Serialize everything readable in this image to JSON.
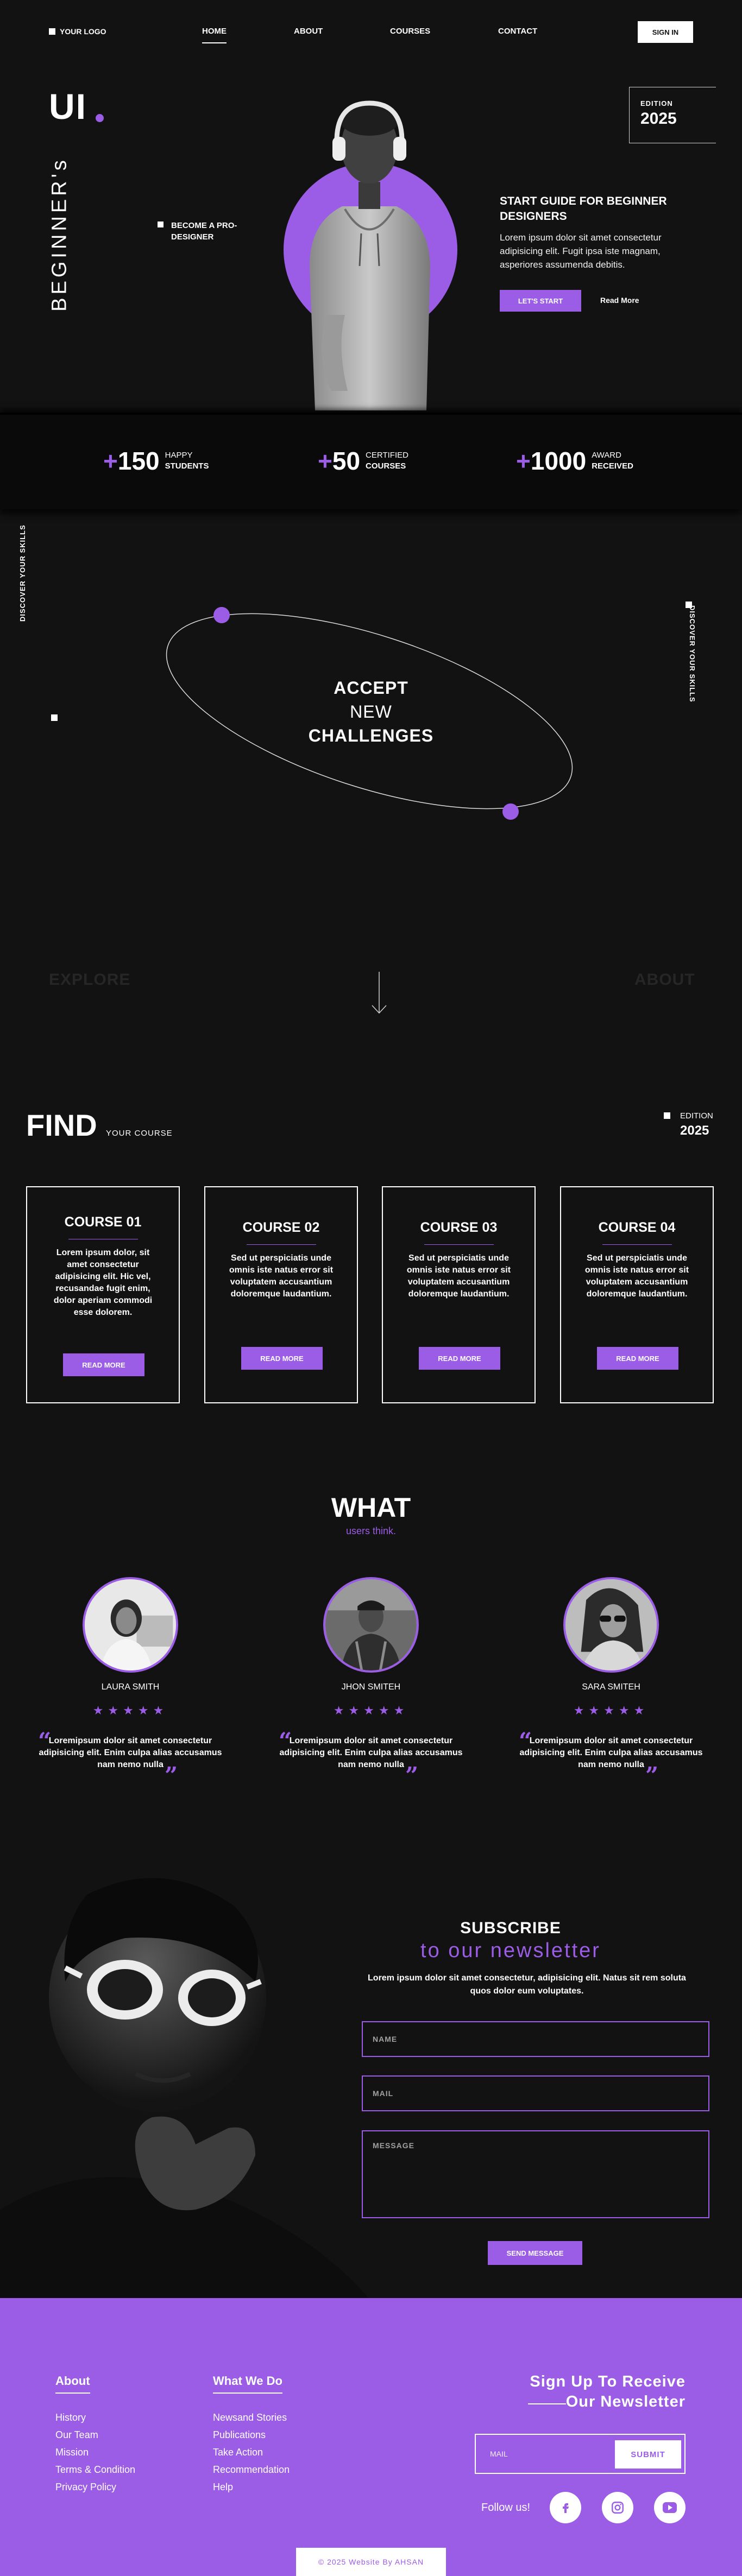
{
  "nav": {
    "logo": "YOUR LOGO",
    "links": [
      "HOME",
      "ABOUT",
      "COURSES",
      "CONTACT"
    ],
    "signin": "SIGN IN"
  },
  "hero": {
    "big": "UI",
    "vertical": "BEGINNER's",
    "become": "BECOME A PRO-DESIGNER",
    "edition_label": "EDITION",
    "edition_year": "2025",
    "title": "START GUIDE FOR BEGINNER DESIGNERS",
    "body": "Lorem ipsum dolor sit amet consectetur adipisicing elit. Fugit ipsa iste magnam, asperiores assumenda debitis.",
    "cta": "LET'S START",
    "read_more": "Read More"
  },
  "stats": [
    {
      "plus": "+",
      "num": "150",
      "l1": "HAPPY",
      "l2": "STUDENTS"
    },
    {
      "plus": "+",
      "num": "50",
      "l1": "CERTIFIED",
      "l2": "COURSES"
    },
    {
      "plus": "+",
      "num": "1000",
      "l1": "AWARD",
      "l2": "RECEIVED"
    }
  ],
  "accept": {
    "side_left": "DISCOVER YOUR SKILLS",
    "side_right": "DISCOVER YOUR SKILLS",
    "line1": "ACCEPT",
    "line2": "NEW",
    "line3": "CHALLENGES",
    "explore": "EXPLORE",
    "about": "ABOUT"
  },
  "find": {
    "title": "FIND",
    "sub": "YOUR COURSE",
    "edition_label": "EDITION",
    "edition_year": "2025",
    "courses": [
      {
        "title": "COURSE 01",
        "body": "Lorem ipsum dolor, sit amet consectetur adipisicing elit. Hic vel, recusandae fugit enim, dolor aperiam commodi esse dolorem.",
        "btn": "READ MORE"
      },
      {
        "title": "COURSE 02",
        "body": "Sed ut perspiciatis unde omnis iste natus error sit voluptatem accusantium doloremque laudantium.",
        "btn": "READ MORE"
      },
      {
        "title": "COURSE 03",
        "body": "Sed ut perspiciatis unde omnis iste natus error sit voluptatem accusantium doloremque laudantium.",
        "btn": "READ MORE"
      },
      {
        "title": "COURSE 04",
        "body": "Sed ut perspiciatis unde omnis iste natus error sit voluptatem accusantium doloremque laudantium.",
        "btn": "READ MORE"
      }
    ]
  },
  "testimonials": {
    "title": "WHAT",
    "sub": "users think.",
    "items": [
      {
        "name": "LAURA SMITH",
        "stars": "★★★★★",
        "quote": "Loremipsum dolor sit amet consectetur adipisicing elit. Enim culpa alias accusamus nam nemo nulla"
      },
      {
        "name": "JHON SMITEH",
        "stars": "★★★★★",
        "quote": "Loremipsum dolor sit amet consectetur adipisicing elit. Enim culpa alias accusamus nam nemo nulla"
      },
      {
        "name": "SARA SMITEH",
        "stars": "★★★★★",
        "quote": "Loremipsum dolor sit amet consectetur adipisicing elit. Enim culpa alias accusamus nam nemo nulla"
      }
    ]
  },
  "subscribe": {
    "title": "SUBSCRIBE",
    "sub": "to our newsletter",
    "body": "Lorem ipsum dolor sit amet consectetur, adipisicing elit. Natus sit rem soluta quos dolor eum voluptates.",
    "name_ph": "NAME",
    "mail_ph": "MAIL",
    "message_ph": "MESSAGE",
    "send": "SEND MESSAGE"
  },
  "footer": {
    "about_head": "About",
    "about_links": [
      "History",
      "Our Team",
      "Mission",
      "Terms & Condition",
      "Privacy Policy"
    ],
    "what_head": "What We Do",
    "what_links": [
      "Newsand Stories",
      "Publications",
      "Take Action",
      "Recommendation",
      "Help"
    ],
    "signup1": "Sign Up To Receive",
    "signup2": "Our Newsletter",
    "mail_ph": "MAIL",
    "submit": "SUBMIT",
    "follow": "Follow us!",
    "social": [
      "facebook-icon",
      "instagram-icon",
      "youtube-icon"
    ],
    "copyright": "© 2025 Website By AHSAN"
  },
  "colors": {
    "accent": "#9b5de5",
    "bg": "#121212",
    "white": "#ffffff"
  }
}
